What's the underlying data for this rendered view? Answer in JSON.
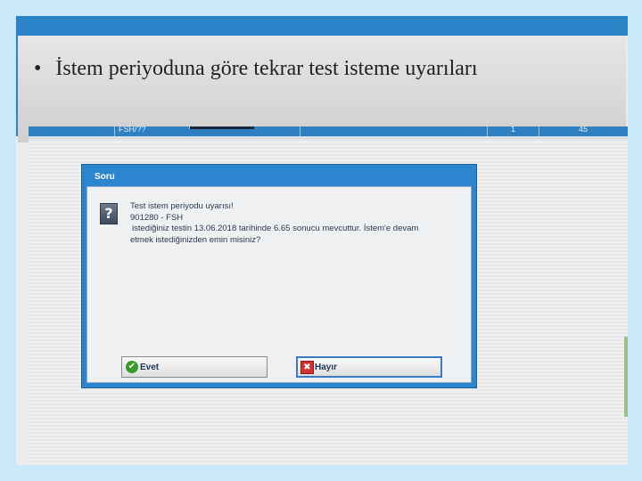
{
  "slide": {
    "bullet": "•",
    "title": "İstem periyoduna göre tekrar test isteme uyarıları"
  },
  "app_header": {
    "col1": "FSH/??",
    "col2": "1",
    "col3": "45"
  },
  "dialog": {
    "title": "Soru",
    "icon": "question-icon",
    "message": {
      "line1": "Test istem periyodu uyarısı!",
      "line2": "901280 - FSH",
      "line3": " istediğiniz testin 13.06.2018 tarihinde 6.65 sonucu mevcuttur. İstem'e devam",
      "line4": "etmek istediğinizden emin misiniz?"
    },
    "buttons": {
      "yes_label": "Evet",
      "no_label": "Hayır"
    }
  },
  "colors": {
    "accent_blue": "#2a83c7",
    "dialog_title_bar": "#2c86cf",
    "yes_icon": "#3b9a2c",
    "no_icon": "#d3322a"
  }
}
